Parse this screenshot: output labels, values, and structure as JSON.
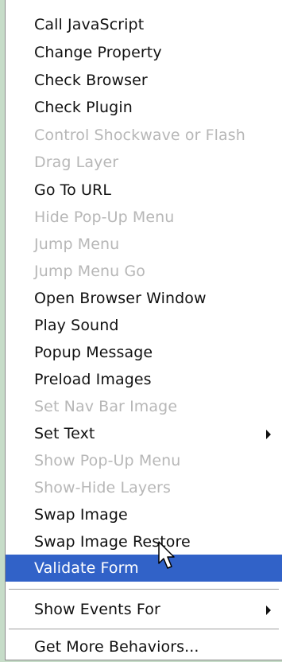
{
  "menu": {
    "items": [
      {
        "label": "Call JavaScript",
        "enabled": true
      },
      {
        "label": "Change Property",
        "enabled": true
      },
      {
        "label": "Check Browser",
        "enabled": true
      },
      {
        "label": "Check Plugin",
        "enabled": true
      },
      {
        "label": "Control Shockwave or Flash",
        "enabled": false
      },
      {
        "label": "Drag Layer",
        "enabled": false
      },
      {
        "label": "Go To URL",
        "enabled": true
      },
      {
        "label": "Hide Pop-Up Menu",
        "enabled": false
      },
      {
        "label": "Jump Menu",
        "enabled": false
      },
      {
        "label": "Jump Menu Go",
        "enabled": false
      },
      {
        "label": "Open Browser Window",
        "enabled": true
      },
      {
        "label": "Play Sound",
        "enabled": true
      },
      {
        "label": "Popup Message",
        "enabled": true
      },
      {
        "label": "Preload Images",
        "enabled": true
      },
      {
        "label": "Set Nav Bar Image",
        "enabled": false
      },
      {
        "label": "Set Text",
        "enabled": true,
        "submenu": true
      },
      {
        "label": "Show Pop-Up Menu",
        "enabled": false
      },
      {
        "label": "Show-Hide Layers",
        "enabled": false
      },
      {
        "label": "Swap Image",
        "enabled": true
      },
      {
        "label": "Swap Image Restore",
        "enabled": true
      },
      {
        "label": "Validate Form",
        "enabled": true,
        "selected": true
      }
    ],
    "show_events_for": {
      "label": "Show Events For",
      "submenu": true
    },
    "get_more": {
      "label": "Get More Behaviors..."
    }
  },
  "colors": {
    "background": "#c6dcc8",
    "selected": "#3162c8",
    "disabled_text": "#b7b7b7"
  },
  "icons": {
    "submenu": "submenu-arrow-icon",
    "cursor": "mouse-pointer-icon"
  }
}
